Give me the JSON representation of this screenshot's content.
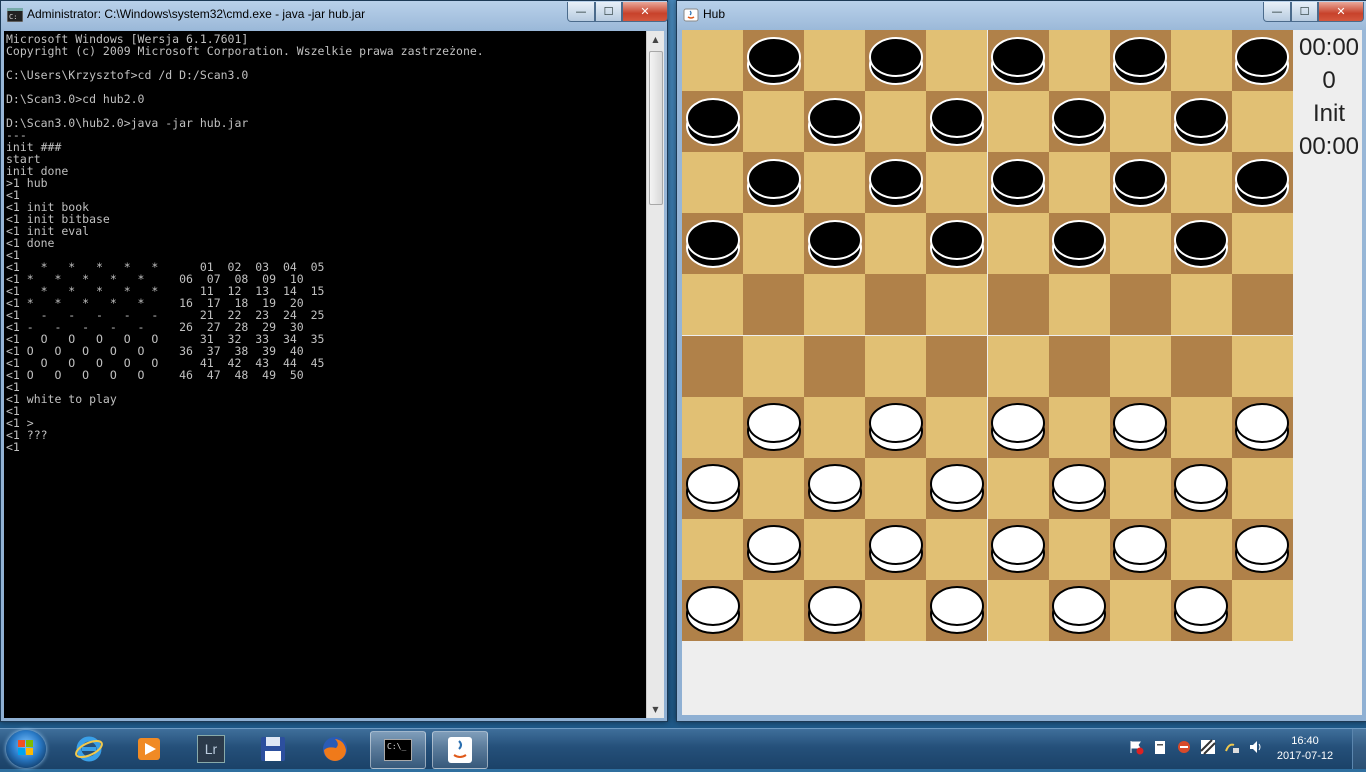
{
  "cmd_window": {
    "title": "Administrator: C:\\Windows\\system32\\cmd.exe - java  -jar hub.jar",
    "caption": {
      "minimize": "—",
      "maximize": "☐",
      "close": "✕"
    },
    "console_text": "Microsoft Windows [Wersja 6.1.7601]\nCopyright (c) 2009 Microsoft Corporation. Wszelkie prawa zastrzeżone.\n\nC:\\Users\\Krzysztof>cd /d D:/Scan3.0\n\nD:\\Scan3.0>cd hub2.0\n\nD:\\Scan3.0\\hub2.0>java -jar hub.jar\n---\ninit ###\nstart\ninit done\n>1 hub\n<1\n<1 init book\n<1 init bitbase\n<1 init eval\n<1 done\n<1\n<1   *   *   *   *   *      01  02  03  04  05\n<1 *   *   *   *   *     06  07  08  09  10\n<1   *   *   *   *   *      11  12  13  14  15\n<1 *   *   *   *   *     16  17  18  19  20\n<1   -   -   -   -   -      21  22  23  24  25\n<1 -   -   -   -   -     26  27  28  29  30\n<1   O   O   O   O   O      31  32  33  34  35\n<1 O   O   O   O   O     36  37  38  39  40\n<1   O   O   O   O   O      41  42  43  44  45\n<1 O   O   O   O   O     46  47  48  49  50\n<1\n<1 white to play\n<1\n<1 >\n<1 ???\n<1"
  },
  "hub_window": {
    "title": "Hub",
    "caption": {
      "minimize": "—",
      "maximize": "☐",
      "close": "✕"
    },
    "side_panel": {
      "clock_top": "00:00",
      "move_count": "0",
      "status": "Init",
      "clock_bottom": "00:00"
    },
    "board": {
      "size": 10,
      "light_color": "#e1c074",
      "dark_color": "#b08149",
      "rows": [
        ".b.b.b.b.b",
        "b.b.b.b.b.",
        ".b.b.b.b.b",
        "b.b.b.b.b.",
        "..........",
        "..........",
        ".w.w.w.w.w",
        "w.w.w.w.w.",
        ".w.w.w.w.w",
        "w.w.w.w.w."
      ],
      "piece_colors": {
        "b": "#000000",
        "w": "#ffffff"
      }
    }
  },
  "taskbar": {
    "buttons": [
      {
        "name": "internet-explorer-taskbar-button",
        "icon": "internet-explorer-icon"
      },
      {
        "name": "media-player-taskbar-button",
        "icon": "media-player-icon"
      },
      {
        "name": "lightroom-taskbar-button",
        "icon": "lightroom-icon",
        "label": "Lr"
      },
      {
        "name": "save-taskbar-button",
        "icon": "floppy-disk-icon"
      },
      {
        "name": "firefox-taskbar-button",
        "icon": "firefox-icon"
      },
      {
        "name": "cmd-taskbar-button",
        "icon": "command-prompt-icon",
        "label": "C:\\_"
      },
      {
        "name": "java-taskbar-button",
        "icon": "java-icon"
      }
    ],
    "clock": {
      "time": "16:40",
      "date": "2017-07-12"
    }
  }
}
